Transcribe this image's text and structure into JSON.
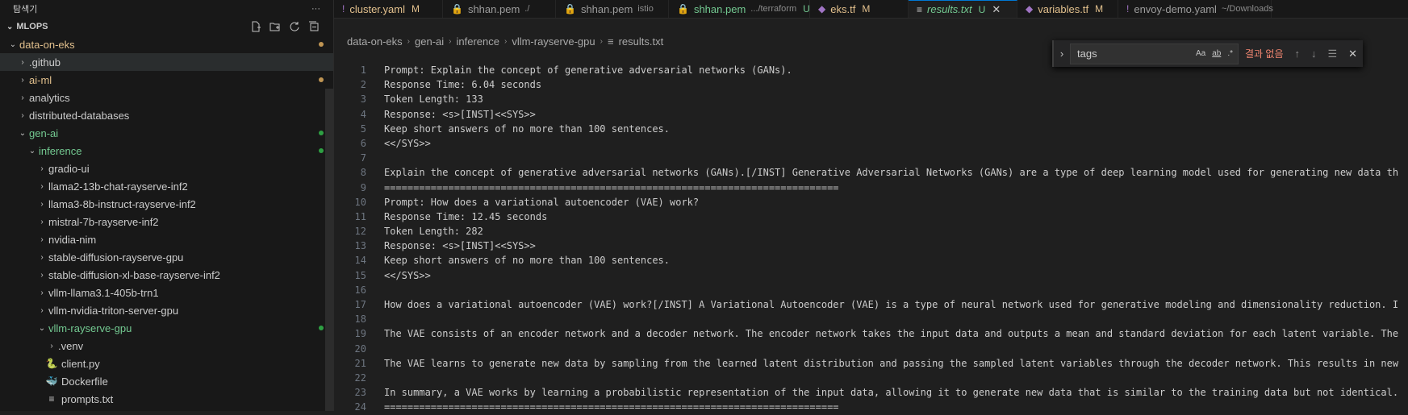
{
  "sidebar": {
    "title": "탐색기",
    "more": "···",
    "section": "MLOPS",
    "tree": [
      {
        "label": "data-on-eks",
        "indent": 1,
        "chev": "⌄",
        "color": "#e2c08d",
        "dot": "#c09553"
      },
      {
        "label": ".github",
        "indent": 2,
        "chev": "›",
        "color": "#cccccc",
        "dot": "",
        "active": true
      },
      {
        "label": "ai-ml",
        "indent": 2,
        "chev": "›",
        "color": "#e2c08d",
        "dot": "#c09553"
      },
      {
        "label": "analytics",
        "indent": 2,
        "chev": "›",
        "color": "#cccccc",
        "dot": ""
      },
      {
        "label": "distributed-databases",
        "indent": 2,
        "chev": "›",
        "color": "#cccccc",
        "dot": ""
      },
      {
        "label": "gen-ai",
        "indent": 2,
        "chev": "⌄",
        "color": "#73c991",
        "dot": "#2ea043"
      },
      {
        "label": "inference",
        "indent": 3,
        "chev": "⌄",
        "color": "#73c991",
        "dot": "#2ea043"
      },
      {
        "label": "gradio-ui",
        "indent": 4,
        "chev": "›",
        "color": "#cccccc",
        "dot": ""
      },
      {
        "label": "llama2-13b-chat-rayserve-inf2",
        "indent": 4,
        "chev": "›",
        "color": "#cccccc",
        "dot": ""
      },
      {
        "label": "llama3-8b-instruct-rayserve-inf2",
        "indent": 4,
        "chev": "›",
        "color": "#cccccc",
        "dot": ""
      },
      {
        "label": "mistral-7b-rayserve-inf2",
        "indent": 4,
        "chev": "›",
        "color": "#cccccc",
        "dot": ""
      },
      {
        "label": "nvidia-nim",
        "indent": 4,
        "chev": "›",
        "color": "#cccccc",
        "dot": ""
      },
      {
        "label": "stable-diffusion-rayserve-gpu",
        "indent": 4,
        "chev": "›",
        "color": "#cccccc",
        "dot": ""
      },
      {
        "label": "stable-diffusion-xl-base-rayserve-inf2",
        "indent": 4,
        "chev": "›",
        "color": "#cccccc",
        "dot": ""
      },
      {
        "label": "vllm-llama3.1-405b-trn1",
        "indent": 4,
        "chev": "›",
        "color": "#cccccc",
        "dot": ""
      },
      {
        "label": "vllm-nvidia-triton-server-gpu",
        "indent": 4,
        "chev": "›",
        "color": "#cccccc",
        "dot": ""
      },
      {
        "label": "vllm-rayserve-gpu",
        "indent": 4,
        "chev": "⌄",
        "color": "#73c991",
        "dot": "#2ea043"
      },
      {
        "label": ".venv",
        "indent": 5,
        "chev": "›",
        "color": "#cccccc",
        "dot": ""
      },
      {
        "label": "client.py",
        "indent": 5,
        "chev": "",
        "icon": "python-icon",
        "color": "#cccccc",
        "dot": ""
      },
      {
        "label": "Dockerfile",
        "indent": 5,
        "chev": "",
        "icon": "docker-icon",
        "color": "#cccccc",
        "dot": ""
      },
      {
        "label": "prompts.txt",
        "indent": 5,
        "chev": "",
        "icon": "text-file-icon",
        "color": "#cccccc",
        "dot": ""
      }
    ]
  },
  "tabs": [
    {
      "label": "cluster.yaml",
      "desc": "",
      "stat": "M",
      "icon": "!",
      "iconColor": "#a074c4",
      "color": "#e2c08d",
      "statColor": "#e2c08d",
      "active": false
    },
    {
      "label": "shhan.pem",
      "desc": "./",
      "stat": "",
      "icon": "🔒",
      "iconColor": "#cccccc",
      "color": "#9d9d9d",
      "statColor": "",
      "active": false
    },
    {
      "label": "shhan.pem",
      "desc": "istio",
      "stat": "",
      "icon": "🔒",
      "iconColor": "#cccccc",
      "color": "#9d9d9d",
      "statColor": "",
      "active": false
    },
    {
      "label": "shhan.pem",
      "desc": ".../terraform",
      "stat": "U",
      "icon": "🔒",
      "iconColor": "#cccccc",
      "color": "#73c991",
      "statColor": "#73c991",
      "active": false
    },
    {
      "label": "eks.tf",
      "desc": "",
      "stat": "M",
      "icon": "◆",
      "iconColor": "#a074c4",
      "color": "#e2c08d",
      "statColor": "#e2c08d",
      "active": false
    },
    {
      "label": "results.txt",
      "desc": "",
      "stat": "U",
      "icon": "≡",
      "iconColor": "#cccccc",
      "color": "#73c991",
      "statColor": "#73c991",
      "active": true
    },
    {
      "label": "variables.tf",
      "desc": "",
      "stat": "M",
      "icon": "◆",
      "iconColor": "#a074c4",
      "color": "#e2c08d",
      "statColor": "#e2c08d",
      "active": false
    },
    {
      "label": "envoy-demo.yaml",
      "desc": "~/Downloads",
      "stat": "",
      "icon": "!",
      "iconColor": "#a074c4",
      "color": "#9d9d9d",
      "statColor": "",
      "active": false
    }
  ],
  "breadcrumb": [
    "data-on-eks",
    "gen-ai",
    "inference",
    "vllm-rayserve-gpu",
    "results.txt"
  ],
  "find": {
    "value": "tags",
    "case": "Aa",
    "word": "ab",
    "regex": ".*",
    "result": "결과 없음"
  },
  "lines": [
    "Prompt: Explain the concept of generative adversarial networks (GANs).",
    "Response Time: 6.04 seconds",
    "Token Length: 133",
    "Response: <s>[INST]<<SYS>>",
    "Keep short answers of no more than 100 sentences.",
    "<</SYS>>",
    "",
    "Explain the concept of generative adversarial networks (GANs).[/INST] Generative Adversarial Networks (GANs) are a type of deep learning model used for generating new data th",
    "==============================================================================",
    "Prompt: How does a variational autoencoder (VAE) work?",
    "Response Time: 12.45 seconds",
    "Token Length: 282",
    "Response: <s>[INST]<<SYS>>",
    "Keep short answers of no more than 100 sentences.",
    "<</SYS>>",
    "",
    "How does a variational autoencoder (VAE) work?[/INST] A Variational Autoencoder (VAE) is a type of neural network used for generative modeling and dimensionality reduction. I",
    "",
    "The VAE consists of an encoder network and a decoder network. The encoder network takes the input data and outputs a mean and standard deviation for each latent variable. The",
    "",
    "The VAE learns to generate new data by sampling from the learned latent distribution and passing the sampled latent variables through the decoder network. This results in new",
    "",
    "In summary, a VAE works by learning a probabilistic representation of the input data, allowing it to generate new data that is similar to the training data but not identical.",
    "=============================================================================="
  ]
}
